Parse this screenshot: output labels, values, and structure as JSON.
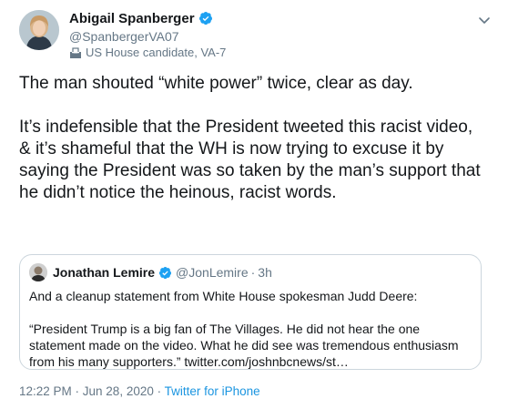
{
  "author": {
    "name": "Abigail Spanberger",
    "handle": "@SpanbergerVA07",
    "label": "US House candidate, VA-7",
    "verified_icon": "verified-badge-icon",
    "label_icon": "ballot-box-icon"
  },
  "tweet": {
    "paragraphs": [
      "The man shouted “white power” twice, clear as day.",
      "It’s indefensible that the President tweeted this racist video, & it’s shameful that the WH is now trying to excuse it by saying the President was so taken by the man’s support that he didn’t notice the heinous, racist words."
    ],
    "timestamp": "12:22 PM · Jun 28, 2020",
    "separator": " · ",
    "source": "Twitter for iPhone"
  },
  "quoted": {
    "name": "Jonathan Lemire",
    "handle": "@JonLemire",
    "dot": "·",
    "time": "3h",
    "paragraphs": [
      "And a cleanup statement from White House spokesman Judd Deere:",
      "“President Trump is a big fan of The Villages. He did not hear the one statement made on the video. What he did see was tremendous enthusiasm from his many supporters.” twitter.com/joshnbcnews/st…"
    ]
  },
  "colors": {
    "verified": "#1da1f2",
    "secondary_text": "#657786",
    "link": "#1b95e0",
    "border": "#ccd6dd"
  }
}
